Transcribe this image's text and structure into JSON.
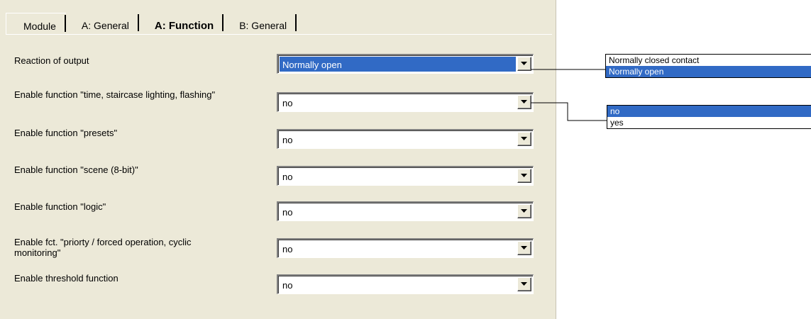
{
  "tabs": [
    "Module",
    "A: General",
    "A: Function",
    "B: General"
  ],
  "active_tab": "A: Function",
  "parameters": [
    {
      "label": "Reaction of output",
      "value": "Normally open"
    },
    {
      "label": "Enable function \"time, staircase lighting, flashing\"",
      "value": "no"
    },
    {
      "label": "Enable function \"presets\"",
      "value": "no"
    },
    {
      "label": "Enable function \"scene (8-bit)\"",
      "value": "no"
    },
    {
      "label": "Enable function \"logic\"",
      "value": "no"
    },
    {
      "label": "Enable fct. \"priorty / forced operation, cyclic monitoring\"",
      "value": "no"
    },
    {
      "label": "Enable threshold function",
      "value": "no"
    }
  ],
  "callout_reaction": {
    "options": [
      "Normally closed contact",
      "Normally open"
    ],
    "selected": "Normally open"
  },
  "callout_time": {
    "options": [
      "no",
      "yes"
    ],
    "selected": "no"
  },
  "colors": {
    "selection": "#316ac5",
    "panel": "#ece9d8"
  },
  "icons": {
    "dropdown_arrow": "chevron-down-icon"
  }
}
